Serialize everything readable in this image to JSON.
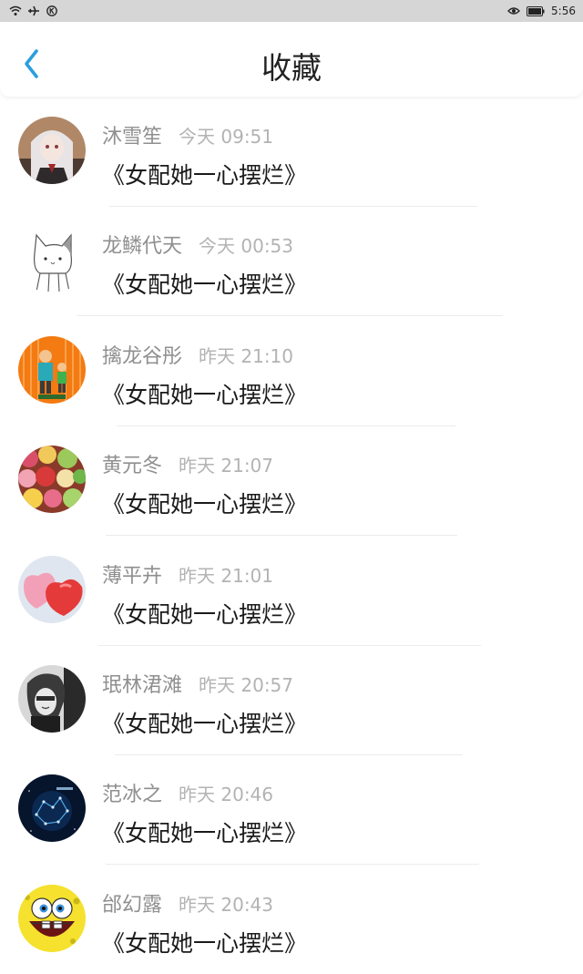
{
  "status_bar": {
    "time": "5:56",
    "left_icons": [
      "wifi-icon",
      "airplane-icon",
      "k-icon"
    ],
    "right_icons": [
      "eye-icon",
      "battery-icon"
    ]
  },
  "header": {
    "title": "收藏",
    "back_icon": "chevron-left-icon",
    "accent_color": "#2a9ee0"
  },
  "favorites": [
    {
      "user": "沐雪笙",
      "time": "今天 09:51",
      "book": "《女配她一心摆烂》",
      "avatar": "anime-girl-avatar"
    },
    {
      "user": "龙鳞代天",
      "time": "今天 00:53",
      "book": "《女配她一心摆烂》",
      "avatar": "cat-sketch-avatar"
    },
    {
      "user": "擒龙谷彤",
      "time": "昨天 21:10",
      "book": "《女配她一心摆烂》",
      "avatar": "cartoon-family-avatar"
    },
    {
      "user": "黄元冬",
      "time": "昨天 21:07",
      "book": "《女配她一心摆烂》",
      "avatar": "candy-avatar"
    },
    {
      "user": "薄平卉",
      "time": "昨天 21:01",
      "book": "《女配她一心摆烂》",
      "avatar": "heart-avatar"
    },
    {
      "user": "珉林涒滩",
      "time": "昨天 20:57",
      "book": "《女配她一心摆烂》",
      "avatar": "bw-portrait-avatar"
    },
    {
      "user": "范冰之",
      "time": "昨天 20:46",
      "book": "《女配她一心摆烂》",
      "avatar": "constellation-avatar"
    },
    {
      "user": "邰幻露",
      "time": "昨天 20:43",
      "book": "《女配她一心摆烂》",
      "avatar": "sponge-face-avatar"
    }
  ]
}
